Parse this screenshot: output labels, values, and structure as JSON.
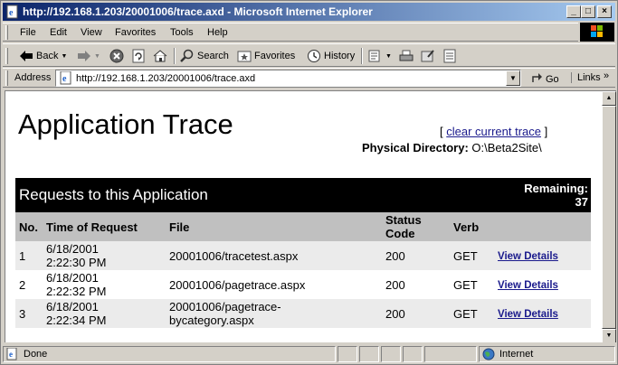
{
  "window": {
    "title": "http://192.168.1.203/20001006/trace.axd - Microsoft Internet Explorer",
    "minimize": "_",
    "maximize": "□",
    "close": "×"
  },
  "menu": [
    "File",
    "Edit",
    "View",
    "Favorites",
    "Tools",
    "Help"
  ],
  "toolbar": {
    "back": "Back",
    "search": "Search",
    "favorites": "Favorites",
    "history": "History"
  },
  "address": {
    "label": "Address",
    "url": "http://192.168.1.203/20001006/trace.axd",
    "go": "Go",
    "links": "Links",
    "links_arrow": "»"
  },
  "page": {
    "title": "Application Trace",
    "clear_open": "[",
    "clear_link": "clear current trace",
    "clear_close": "]",
    "physdir_label": "Physical Directory:",
    "physdir_value": "O:\\Beta2Site\\"
  },
  "table": {
    "heading": "Requests to this Application",
    "remaining_label": "Remaining:",
    "remaining_value": "37",
    "columns": [
      "No.",
      "Time of Request",
      "File",
      "Status Code",
      "Verb",
      ""
    ],
    "rows": [
      {
        "no": "1",
        "date": "6/18/2001",
        "time": "2:22:30 PM",
        "file1": "20001006/tracetest.aspx",
        "file2": "",
        "status": "200",
        "verb": "GET",
        "link": "View Details"
      },
      {
        "no": "2",
        "date": "6/18/2001",
        "time": "2:22:32 PM",
        "file1": "20001006/pagetrace.aspx",
        "file2": "",
        "status": "200",
        "verb": "GET",
        "link": "View Details"
      },
      {
        "no": "3",
        "date": "6/18/2001",
        "time": "2:22:34 PM",
        "file1": "20001006/pagetrace-",
        "file2": "bycategory.aspx",
        "status": "200",
        "verb": "GET",
        "link": "View Details"
      }
    ]
  },
  "status": {
    "text": "Done",
    "zone": "Internet"
  },
  "colors": {
    "titlebar_start": "#0a246a",
    "titlebar_end": "#a6caf0",
    "link": "#1a1a8c",
    "chrome": "#d4d0c8"
  }
}
